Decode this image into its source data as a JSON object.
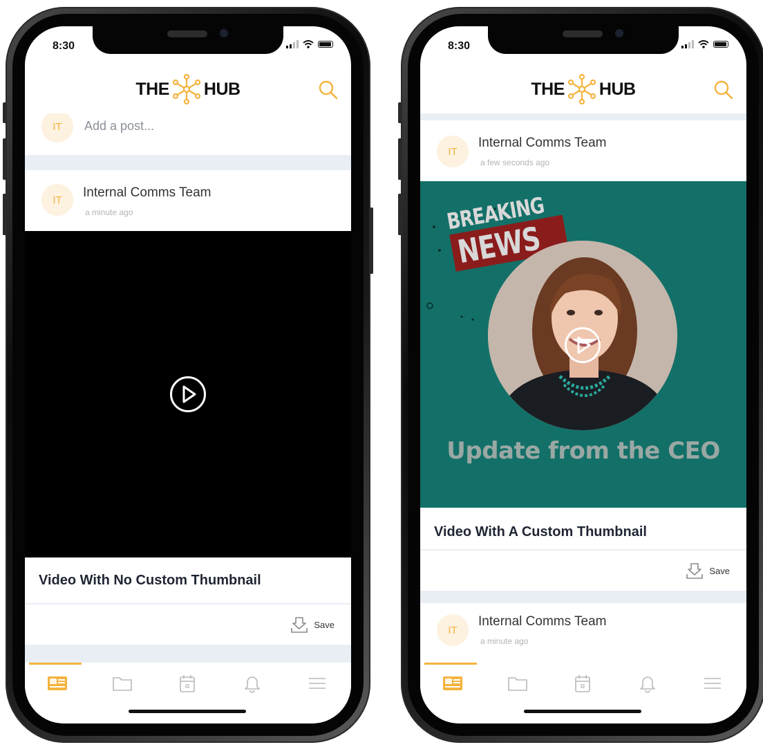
{
  "status_bar": {
    "time": "8:30"
  },
  "app": {
    "logo_left": "THE",
    "logo_right": "HUB",
    "accent_color": "#f4b33e"
  },
  "left_phone": {
    "composer": {
      "avatar_initials": "IT",
      "placeholder": "Add a post..."
    },
    "post": {
      "author": "Internal Comms Team",
      "time": "a minute ago",
      "avatar_initials": "IT",
      "title": "Video With No Custom Thumbnail",
      "save_label": "Save"
    }
  },
  "right_phone": {
    "post": {
      "author": "Internal Comms Team",
      "time": "a few seconds ago",
      "avatar_initials": "IT",
      "title": "Video With A Custom Thumbnail",
      "save_label": "Save",
      "thumbnail": {
        "badge_line1": "BREAKING",
        "badge_line2": "NEWS",
        "caption": "Update from the CEO",
        "bg_color": "#137068"
      }
    },
    "next_post": {
      "author": "Internal Comms Team",
      "time": "a minute ago",
      "avatar_initials": "IT"
    }
  },
  "tabbar": {
    "icons": [
      "news-feed-icon",
      "folder-icon",
      "calendar-icon",
      "bell-icon",
      "menu-icon"
    ]
  }
}
